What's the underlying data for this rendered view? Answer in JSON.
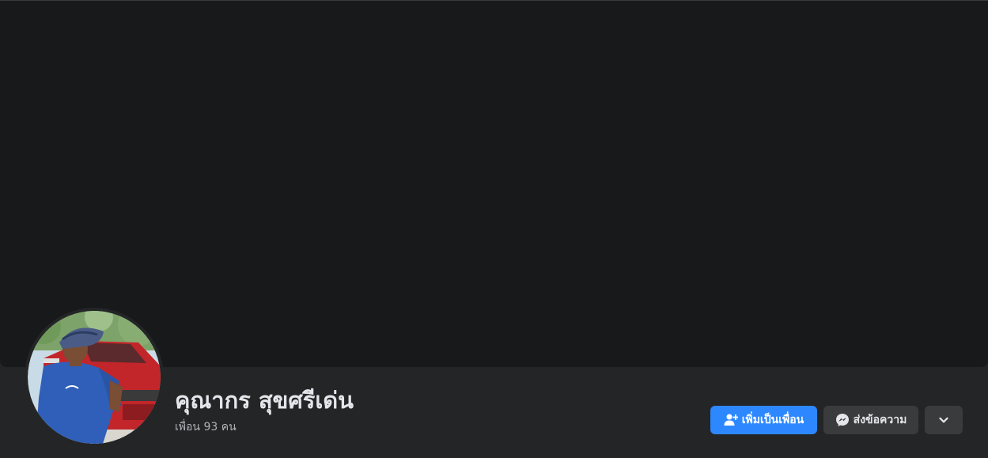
{
  "profile": {
    "name": "คุณากร สุขศรีเด่น",
    "friends_text": "เพื่อน 93 คน"
  },
  "actions": {
    "add_friend_label": "เพิ่มเป็นเพื่อน",
    "message_label": "ส่งข้อความ",
    "more_icon": "chevron-down-icon"
  },
  "colors": {
    "cover_bg": "#18191a",
    "page_bg": "#242526",
    "primary_button": "#2d88ff",
    "secondary_button": "#3a3b3c",
    "name_text": "#e4e6eb",
    "secondary_text": "#b0b3b8"
  }
}
